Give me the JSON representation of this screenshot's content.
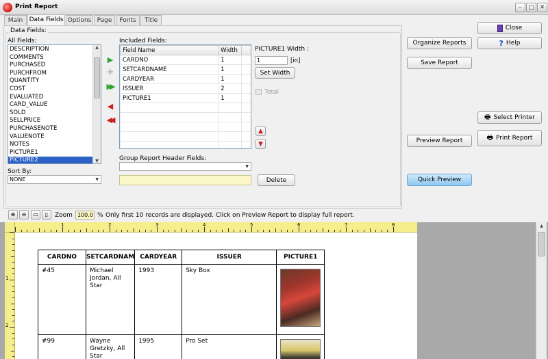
{
  "window": {
    "title": "Print Report"
  },
  "tabs": [
    {
      "label": "Main"
    },
    {
      "label": "Data Fields"
    },
    {
      "label": "Options"
    },
    {
      "label": "Page"
    },
    {
      "label": "Fonts"
    },
    {
      "label": "Title"
    }
  ],
  "data_fields": {
    "group_label": "Data Fields:",
    "all_fields_label": "All Fields:",
    "all_fields": [
      "DESCRIPTION",
      "COMMENTS",
      "PURCHASED",
      "PURCHFROM",
      "QUANTITY",
      "COST",
      "EVALUATED",
      "CARD_VALUE",
      "SOLD",
      "SELLPRICE",
      "PURCHASENOTE",
      "VALUENOTE",
      "NOTES",
      "PICTURE1",
      "PICTURE2"
    ],
    "all_fields_selected": "PICTURE2",
    "sort_by_label": "Sort By:",
    "sort_by_value": "NONE",
    "included_fields_label": "Included Fields:",
    "col_field_name": "Field Name",
    "col_width": "Width",
    "included_fields": [
      {
        "name": "CARDNO",
        "width": "1"
      },
      {
        "name": "SETCARDNAME",
        "width": "1"
      },
      {
        "name": "CARDYEAR",
        "width": "1"
      },
      {
        "name": "ISSUER",
        "width": "2"
      },
      {
        "name": "PICTURE1",
        "width": "1"
      }
    ],
    "width_label": "PICTURE1 Width :",
    "width_value": "1",
    "width_unit": "[in]",
    "set_width_button": "Set Width",
    "total_label": "Total",
    "group_header_label": "Group Report Header Fields:",
    "group_header_value": "",
    "group_header_input": "",
    "delete_button": "Delete"
  },
  "right_buttons": {
    "organize": "Organize Reports",
    "save": "Save Report",
    "preview": "Preview Report",
    "quick_preview": "Quick Preview",
    "close": "Close",
    "help": "Help",
    "select_printer": "Select Printer",
    "print": "Print Report"
  },
  "zoom": {
    "label": "Zoom",
    "value": "100.0",
    "unit": "%",
    "message": "Only first 10 records are displayed. Click on Preview Report to display full report."
  },
  "ruler": {
    "h_ticks": [
      "1",
      "2",
      "3",
      "4",
      "5",
      "6",
      "7",
      "8"
    ],
    "v_ticks": [
      "1",
      "2"
    ]
  },
  "report": {
    "headers": [
      "CARDNO",
      "SETCARDNAM",
      "CARDYEAR",
      "ISSUER",
      "PICTURE1"
    ],
    "rows": [
      {
        "cardno": "#45",
        "setcardname": "Michael Jordan, All Star",
        "cardyear": "1993",
        "issuer": "Sky Box"
      },
      {
        "cardno": "#99",
        "setcardname": "Wayne Gretzky, All Star",
        "cardyear": "1995",
        "issuer": "Pro Set"
      }
    ]
  },
  "colors": {
    "ruler": "#f6ee8a",
    "selection": "#2c62c5",
    "quick_preview": "#8fc7ef"
  }
}
